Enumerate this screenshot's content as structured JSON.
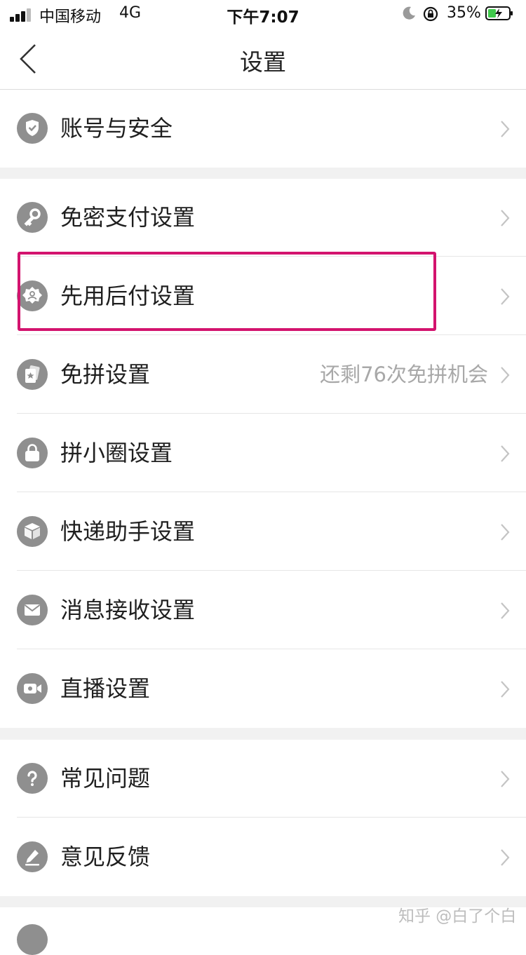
{
  "status_bar": {
    "carrier": "中国移动",
    "network": "4G",
    "time": "下午7:07",
    "battery": "35%"
  },
  "header": {
    "title": "设置"
  },
  "settings": {
    "account": {
      "label": "账号与安全",
      "icon": "shield-icon"
    },
    "pwd_free": {
      "label": "免密支付设置",
      "icon": "key-icon"
    },
    "pay_later": {
      "label": "先用后付设置",
      "icon": "badge-user-icon"
    },
    "group_free": {
      "label": "免拼设置",
      "value": "还剩76次免拼机会",
      "icon": "card-star-icon"
    },
    "circle": {
      "label": "拼小圈设置",
      "icon": "bag-icon"
    },
    "delivery": {
      "label": "快递助手设置",
      "icon": "package-icon"
    },
    "messages": {
      "label": "消息接收设置",
      "icon": "envelope-icon"
    },
    "live": {
      "label": "直播设置",
      "icon": "video-camera-icon"
    },
    "faq": {
      "label": "常见问题",
      "icon": "question-icon"
    },
    "feedback": {
      "label": "意见反馈",
      "icon": "pencil-icon"
    }
  },
  "watermark": "知乎 @白了个白",
  "colors": {
    "highlight": "#d3136e",
    "icon_gray": "#8f8f8f",
    "battery_green": "#3fc94b"
  }
}
